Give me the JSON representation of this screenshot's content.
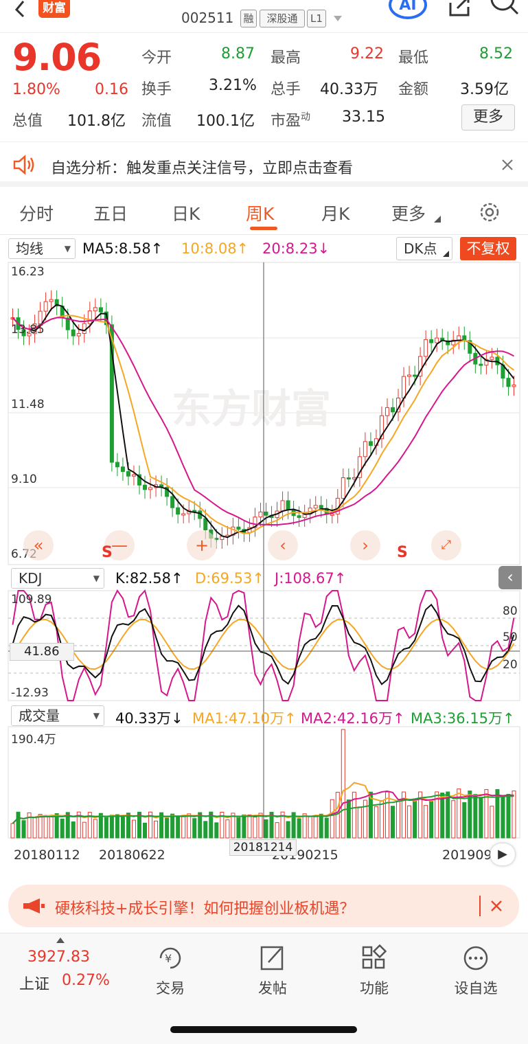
{
  "header": {
    "brand": "财富",
    "code": "002511",
    "tags": [
      "融",
      "深股通",
      "L1"
    ],
    "ai_label": "AI"
  },
  "quote": {
    "price": "9.06",
    "change_pct": "1.80%",
    "change": "0.16",
    "fields": [
      {
        "label": "今开",
        "value": "8.87",
        "color": "green"
      },
      {
        "label": "最高",
        "value": "9.22",
        "color": "red"
      },
      {
        "label": "最低",
        "value": "8.52",
        "color": "green"
      },
      {
        "label": "换手",
        "value": "3.21%",
        "color": "none"
      },
      {
        "label": "总手",
        "value": "40.33万",
        "color": "none"
      },
      {
        "label": "金额",
        "value": "3.59亿",
        "color": "none"
      },
      {
        "label": "总值",
        "value": "101.8亿",
        "color": "none"
      },
      {
        "label": "流值",
        "value": "100.1亿",
        "color": "none"
      },
      {
        "label": "市盈",
        "sup": "动",
        "value": "33.15",
        "color": "none"
      }
    ],
    "more_label": "更多"
  },
  "notice": {
    "text": "自选分析：触发重点关注信号，立即点击查看"
  },
  "tabs": [
    "分时",
    "五日",
    "日K",
    "周K",
    "月K",
    "更多"
  ],
  "active_tab": "周K",
  "kline": {
    "selector": "均线",
    "ma5": "MA5:8.58↑",
    "ma10": "10:8.08↑",
    "ma20": "20:8.23↓",
    "dk_label": "DK点",
    "fq_label": "不复权",
    "y_labels": [
      "16.23",
      "13.85",
      "11.48",
      "9.10",
      "6.72"
    ],
    "watermark": "东方财富",
    "s_mark": "S",
    "colors": {
      "up": "#e8362b",
      "down": "#1e9e33",
      "ma5": "#111111",
      "ma10": "#f5a623",
      "ma20": "#d6168c"
    }
  },
  "kdj": {
    "selector": "KDJ",
    "k": "K:82.58↑",
    "d": "D:69.53↑",
    "j": "J:108.67↑",
    "y_labels": [
      "109.89",
      "-12.93"
    ],
    "right_labels": [
      "80",
      "50",
      "20"
    ],
    "cursor_value": "41.86"
  },
  "volume": {
    "selector": "成交量",
    "value": "40.33万↓",
    "ma1": "MA1:47.10万↑",
    "ma2": "MA2:42.16万↑",
    "ma3": "MA3:36.15万↑",
    "top_label": "190.4万",
    "dates": [
      "20180112",
      "20180622",
      "20190215",
      "201909"
    ],
    "cursor_date": "20181214"
  },
  "banner": {
    "text": "硬核科技+成长引擎！如何把握创业板机遇？"
  },
  "bottom_nav": {
    "index_value": "3927.83",
    "index_name": "上证",
    "index_pct": "0.27%",
    "items": [
      "交易",
      "发帖",
      "功能",
      "设自选"
    ]
  }
}
